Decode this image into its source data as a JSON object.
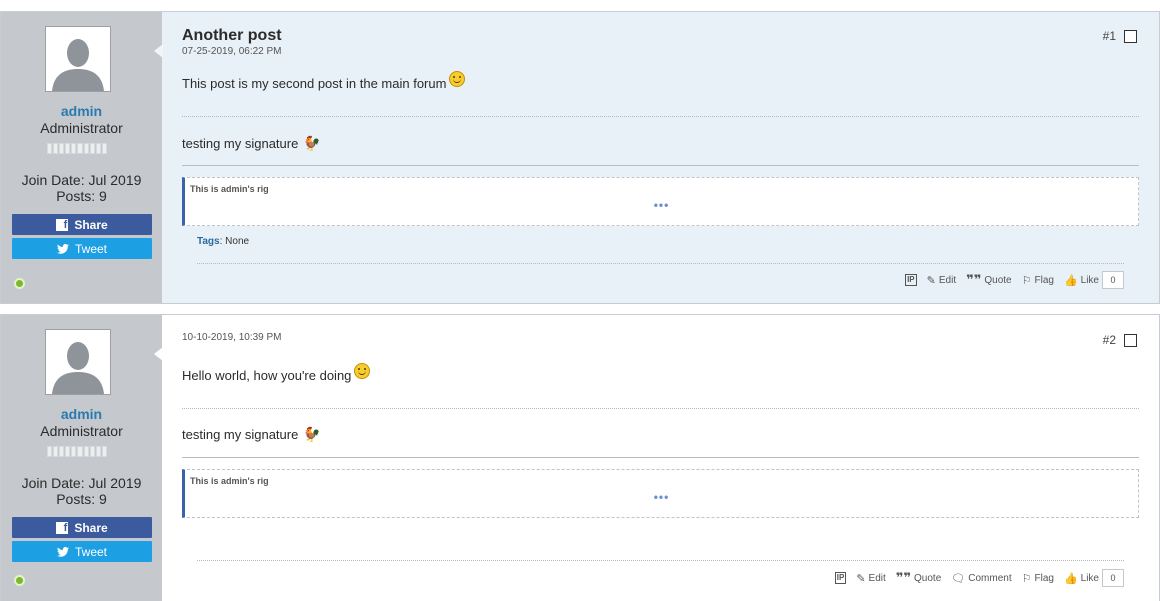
{
  "posts": [
    {
      "title": "Another post",
      "date": "07-25-2019, 06:22 PM",
      "number": "#1",
      "body": "This post is my second post in the main forum",
      "signature": "testing my signature",
      "quote_text": "This is admin's rig",
      "quote_more": "•••",
      "tags_label": "Tags",
      "tags_value": ": None",
      "user": {
        "name": "admin",
        "role": "Administrator",
        "join": "Join Date: Jul 2019",
        "posts": "Posts: 9"
      },
      "share_label": "Share",
      "tweet_label": "Tweet",
      "actions": {
        "ip": "IP",
        "edit": "Edit",
        "quote": "Quote",
        "flag": "Flag",
        "like": "Like",
        "like_count": "0"
      }
    },
    {
      "title": "",
      "date": "10-10-2019, 10:39 PM",
      "number": "#2",
      "body": "Hello world, how you're doing",
      "signature": "testing my signature",
      "quote_text": "This is admin's rig",
      "quote_more": "•••",
      "user": {
        "name": "admin",
        "role": "Administrator",
        "join": "Join Date: Jul 2019",
        "posts": "Posts: 9"
      },
      "share_label": "Share",
      "tweet_label": "Tweet",
      "actions": {
        "ip": "IP",
        "edit": "Edit",
        "quote": "Quote",
        "comment": "Comment",
        "flag": "Flag",
        "like": "Like",
        "like_count": "0"
      }
    }
  ],
  "colors": {
    "username": "#2a7ab0",
    "facebook": "#3b5b9e",
    "twitter": "#1d9fe4",
    "online": "#7ab929",
    "post1_bg": "#e8f1f8",
    "sidebar_bg": "#c5c9cd"
  }
}
